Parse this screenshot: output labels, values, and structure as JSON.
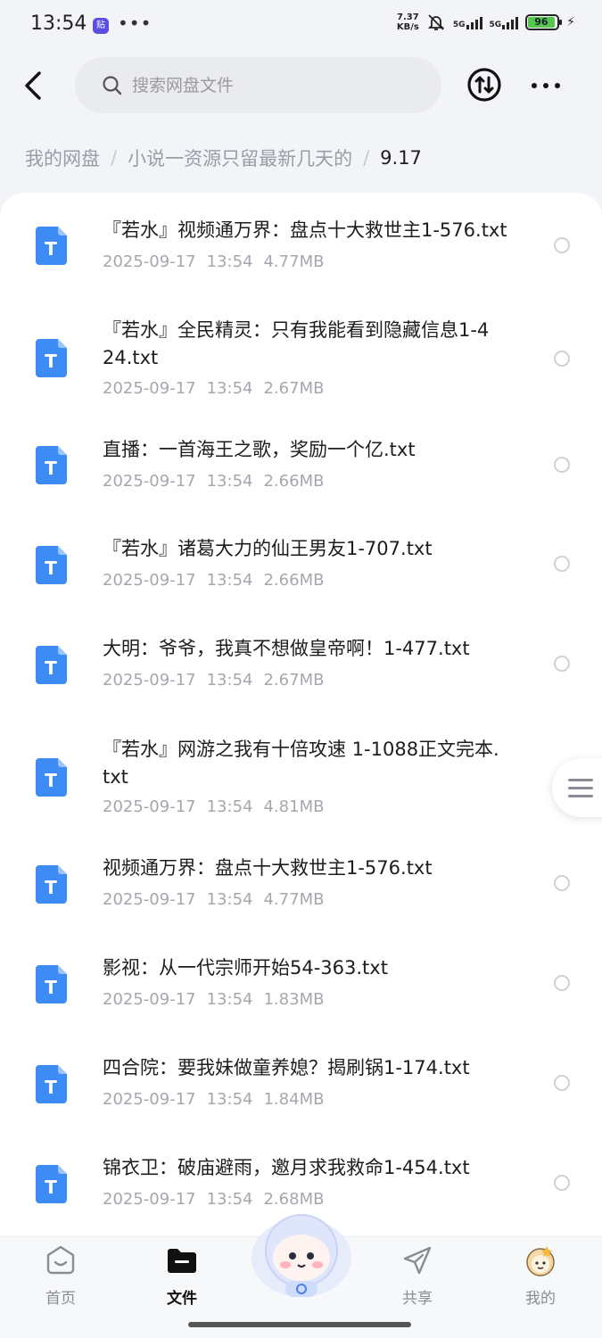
{
  "status_bar": {
    "time": "13:54",
    "app_badge": "贴",
    "dots": "•••",
    "net_speed_value": "7.37",
    "net_speed_unit": "KB/s",
    "signal1": "5G",
    "signal2": "5G",
    "battery": "96"
  },
  "header": {
    "search_placeholder": "搜索网盘文件"
  },
  "breadcrumb": {
    "items": [
      "我的网盘",
      "小说一资源只留最新几天的",
      "9.17"
    ]
  },
  "files": [
    {
      "name": "『若水』视频通万界：盘点十大救世主1-576.txt",
      "date": "2025-09-17",
      "time": "13:54",
      "size": "4.77MB"
    },
    {
      "name": "『若水』全民精灵：只有我能看到隐藏信息1-424.txt",
      "date": "2025-09-17",
      "time": "13:54",
      "size": "2.67MB"
    },
    {
      "name": "直播：一首海王之歌，奖励一个亿.txt",
      "date": "2025-09-17",
      "time": "13:54",
      "size": "2.66MB"
    },
    {
      "name": "『若水』诸葛大力的仙王男友1-707.txt",
      "date": "2025-09-17",
      "time": "13:54",
      "size": "2.66MB"
    },
    {
      "name": "大明：爷爷，我真不想做皇帝啊！1-477.txt",
      "date": "2025-09-17",
      "time": "13:54",
      "size": "2.67MB"
    },
    {
      "name": "『若水』网游之我有十倍攻速  1-1088正文完本.txt",
      "date": "2025-09-17",
      "time": "13:54",
      "size": "4.81MB"
    },
    {
      "name": "视频通万界：盘点十大救世主1-576.txt",
      "date": "2025-09-17",
      "time": "13:54",
      "size": "4.77MB"
    },
    {
      "name": "影视：从一代宗师开始54-363.txt",
      "date": "2025-09-17",
      "time": "13:54",
      "size": "1.83MB"
    },
    {
      "name": "四合院：要我妹做童养媳？揭刷锅1-174.txt",
      "date": "2025-09-17",
      "time": "13:54",
      "size": "1.84MB"
    },
    {
      "name": "锦衣卫：破庙避雨，邀月求我救命1-454.txt",
      "date": "2025-09-17",
      "time": "13:54",
      "size": "2.68MB"
    }
  ],
  "file_icon_letter": "T",
  "bottom_nav": {
    "home": "首页",
    "files": "文件",
    "share": "共享",
    "mine": "我的"
  },
  "colors": {
    "accent_blue": "#3d8bf5",
    "page_bg": "#f3f4f8"
  }
}
